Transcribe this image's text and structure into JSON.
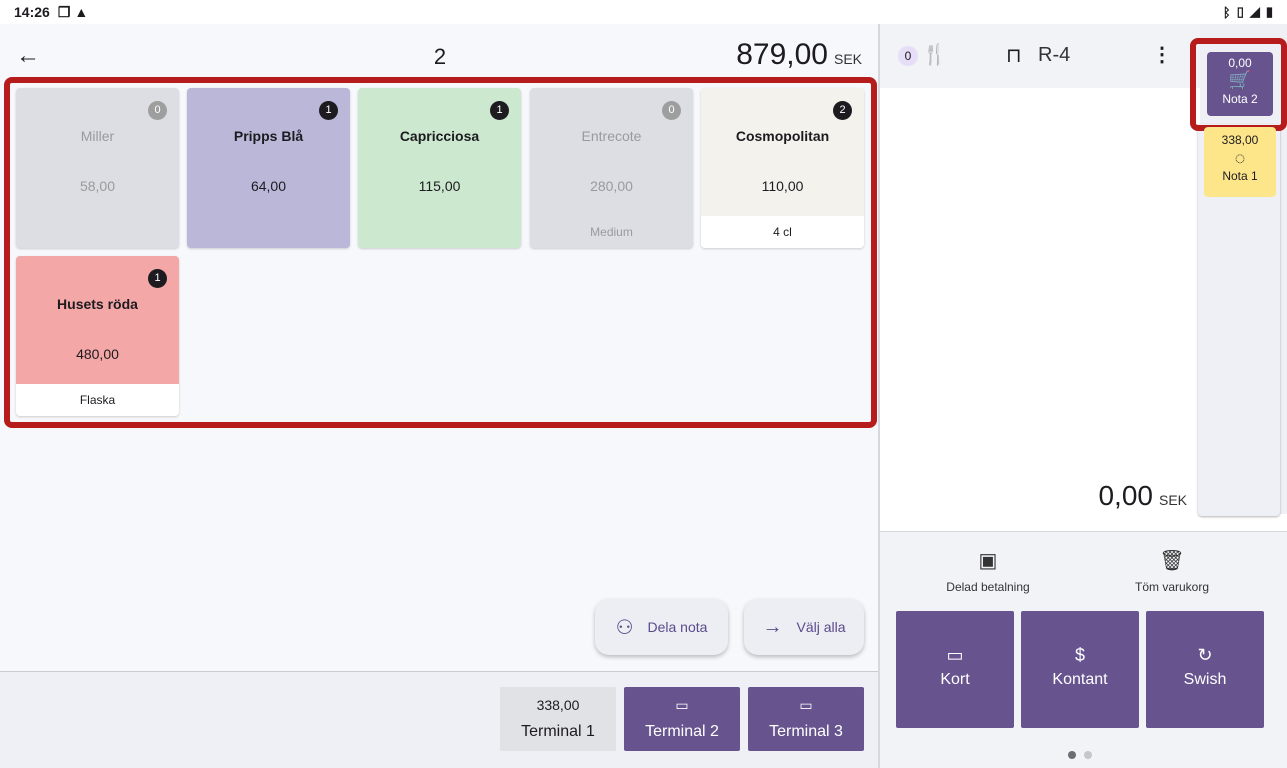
{
  "statusbar": {
    "time": "14:26"
  },
  "header": {
    "back_icon": "arrow-left-icon",
    "order_number": "2",
    "total": "879,00",
    "currency": "SEK"
  },
  "tiles": [
    {
      "name": "Miller",
      "price": "58,00",
      "count": "0",
      "sub": ""
    },
    {
      "name": "Pripps Blå",
      "price": "64,00",
      "count": "1",
      "sub": ""
    },
    {
      "name": "Capricciosa",
      "price": "115,00",
      "count": "1",
      "sub": ""
    },
    {
      "name": "Entrecote",
      "price": "280,00",
      "count": "0",
      "sub": "Medium"
    },
    {
      "name": "Cosmopolitan",
      "price": "110,00",
      "count": "2",
      "sub": "4 cl"
    },
    {
      "name": "Husets röda",
      "price": "480,00",
      "count": "1",
      "sub": "Flaska"
    }
  ],
  "fabs": {
    "split_label": "Dela nota",
    "select_all_label": "Välj alla"
  },
  "terminals": [
    {
      "amount": "338,00",
      "label": "Terminal 1"
    },
    {
      "amount": "",
      "label": "Terminal 2"
    },
    {
      "amount": "",
      "label": "Terminal 3"
    }
  ],
  "right": {
    "guests": "0",
    "table_name": "R-4",
    "cart_active": {
      "amount": "0,00",
      "label": "Nota 2"
    },
    "nota1": {
      "amount": "338,00",
      "label": "Nota 1"
    },
    "total": "0,00",
    "currency": "SEK",
    "actions": {
      "split_payment": "Delad betalning",
      "empty_cart": "Töm varukorg"
    },
    "pay": {
      "card": "Kort",
      "cash": "Kontant",
      "swish": "Swish"
    }
  },
  "colors": {
    "accent": "#67548f",
    "highlight": "#b71c1c"
  }
}
